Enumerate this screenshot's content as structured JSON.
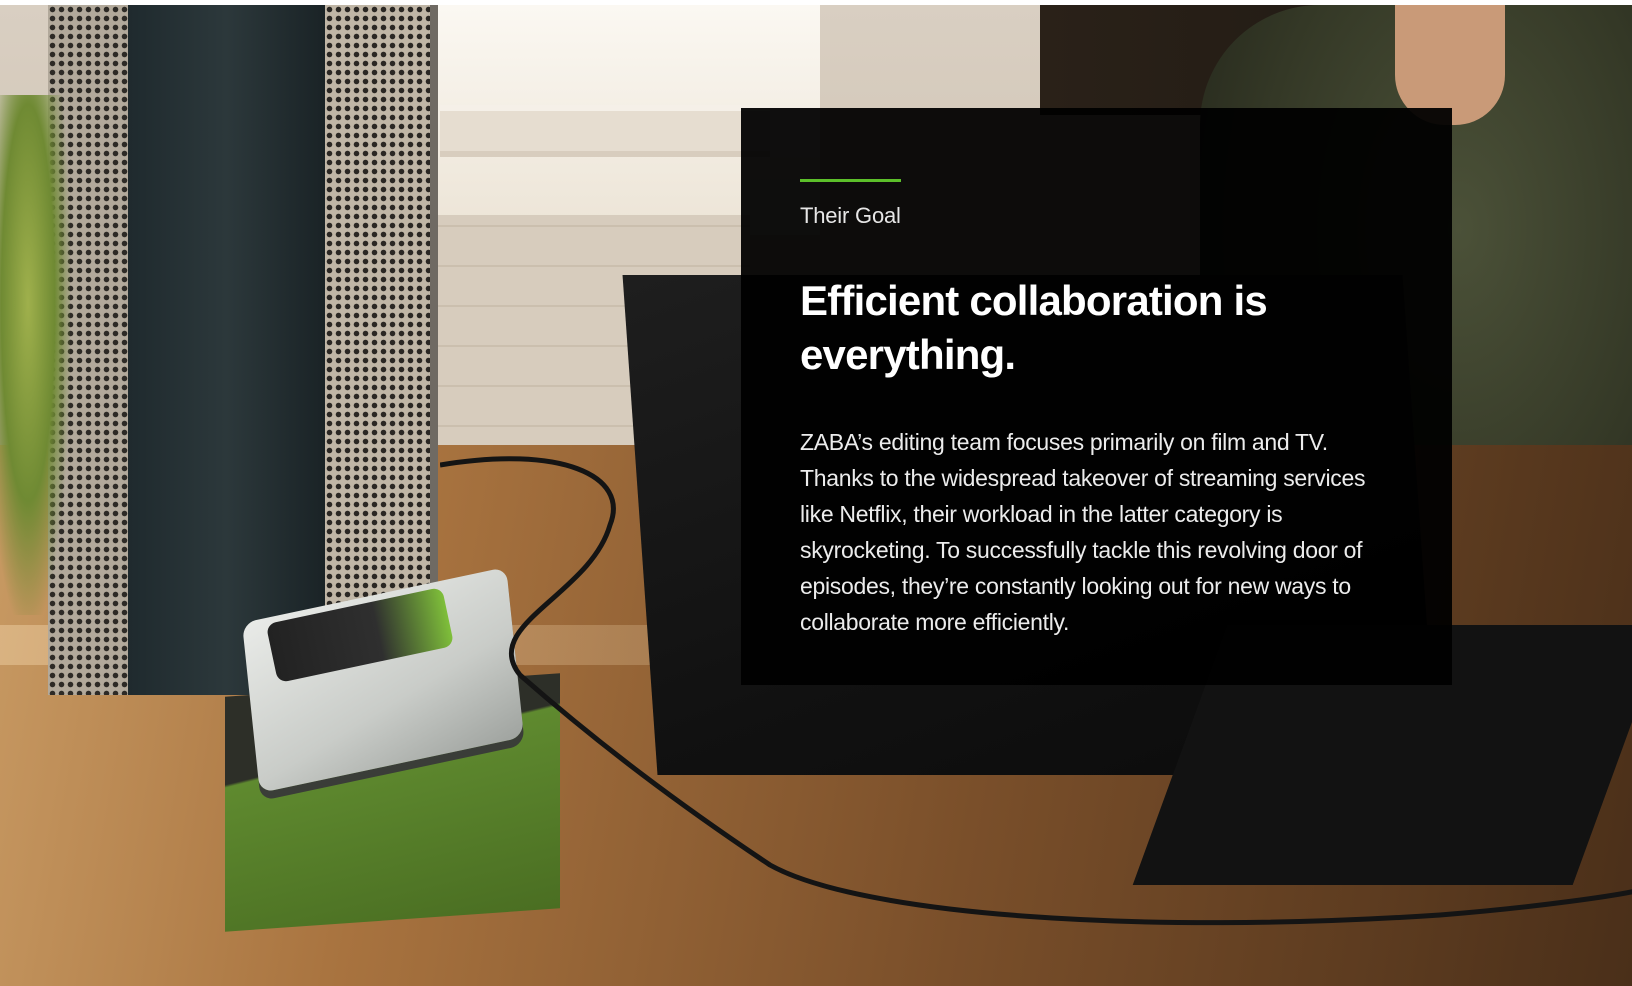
{
  "section": {
    "eyebrow": "Their Goal",
    "heading": "Efficient collaboration is everything.",
    "body": "ZABA’s editing team focuses primarily on film and TV. Thanks to the widespread takeover of streaming services like Netflix, their workload in the latter category is skyrocketing. To successfully tackle this revolving door of episodes, they’re constantly looking out for new ways to collaborate more efficiently."
  },
  "colors": {
    "accent": "#5cbf2a",
    "card_background": "#000000",
    "text": "#ffffff"
  },
  "hero_image": {
    "description_icon": "photo-background"
  }
}
